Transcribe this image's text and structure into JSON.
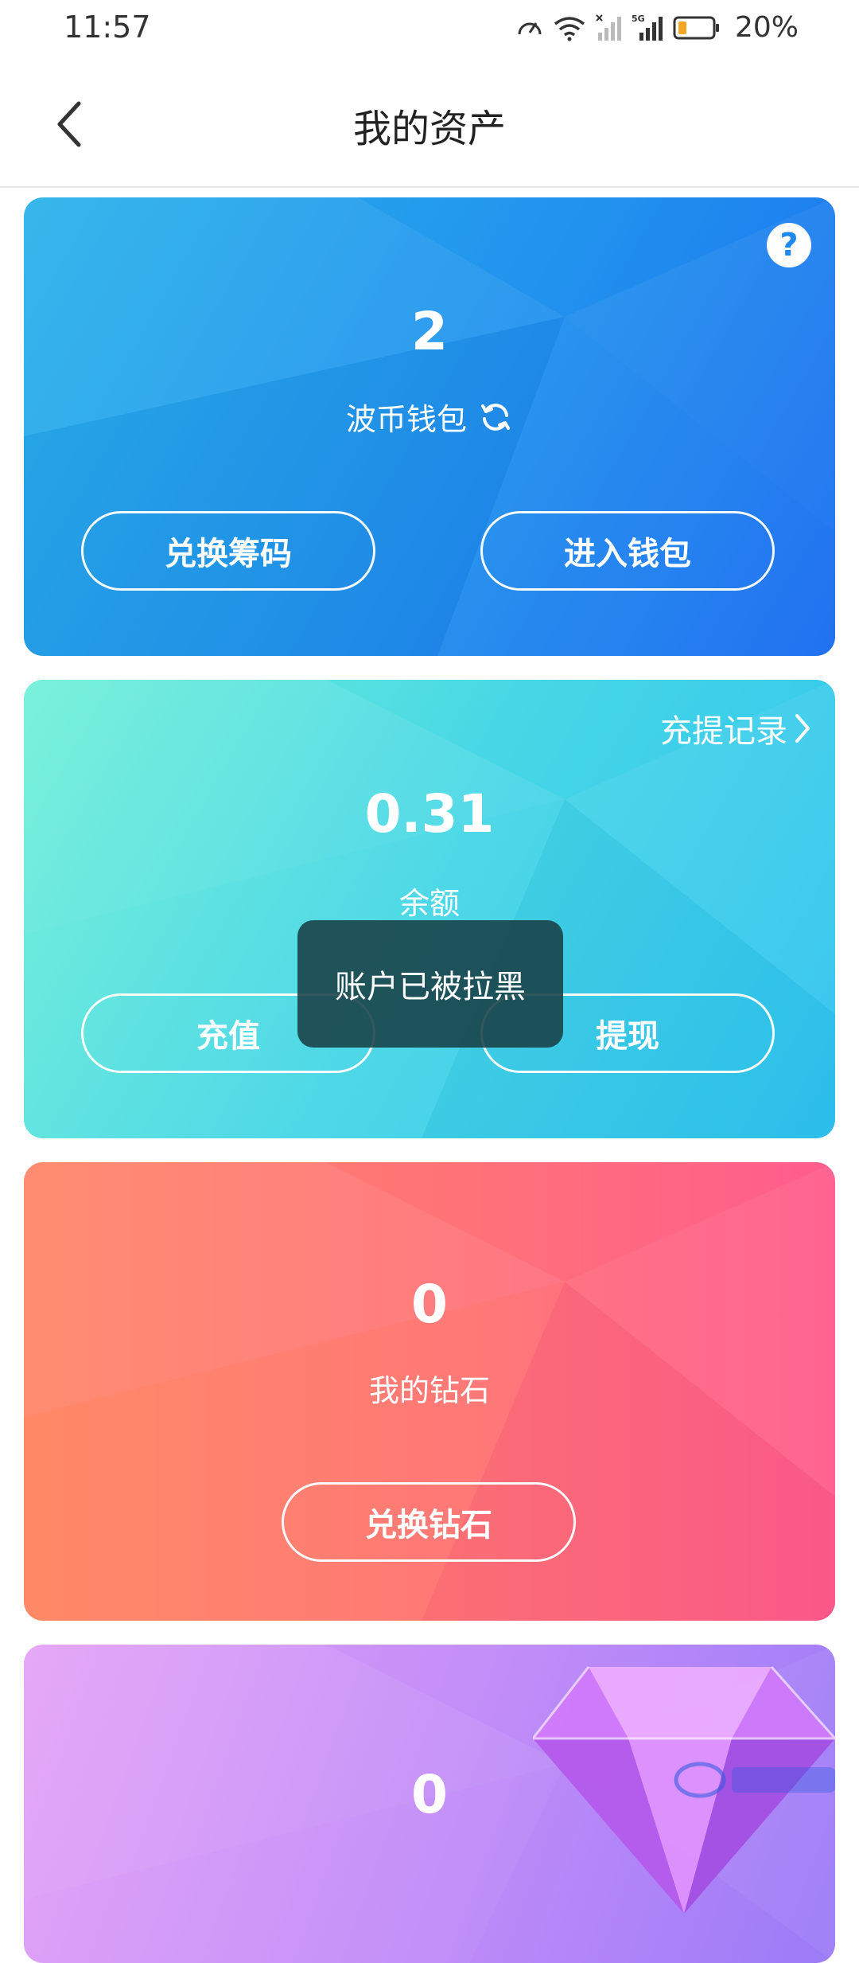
{
  "status_bar": {
    "time": "11:57",
    "battery": "20%"
  },
  "header": {
    "title": "我的资产"
  },
  "cards": {
    "bobi": {
      "amount": "2",
      "label": "波币钱包",
      "exchange_button": "兑换筹码",
      "wallet_button": "进入钱包"
    },
    "balance": {
      "record_link": "充提记录",
      "amount": "0.31",
      "label": "余额",
      "recharge_button": "充值",
      "withdraw_button": "提现"
    },
    "diamond": {
      "amount": "0",
      "label": "我的钻石",
      "exchange_button": "兑换钻石"
    },
    "purple": {
      "amount": "0"
    }
  },
  "toast": {
    "message": "账户已被拉黑"
  },
  "colors": {
    "bobi_card": "#2191ee",
    "balance_card": "#45d6e6",
    "diamond_card": "#ff7278",
    "purple_card": "#c08cf8"
  }
}
